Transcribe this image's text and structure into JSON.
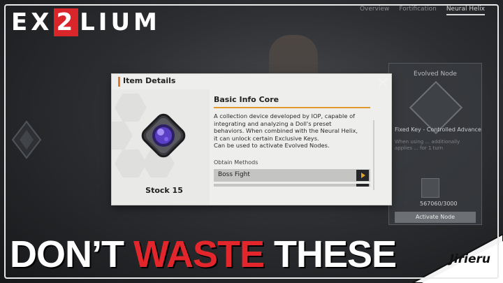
{
  "logo": {
    "prefix": "EX",
    "mark": "2",
    "suffix": "LIUM"
  },
  "game_tabs": [
    "Overview",
    "Fortification",
    "Neural Helix"
  ],
  "side_panel": {
    "title": "Evolved Node",
    "key_label": "Fixed Key - Controlled Advance",
    "description": "When using ... additionally applies ... for 1 turn",
    "count": "567060/3000",
    "activate_label": "Activate Node"
  },
  "modal": {
    "header": "Item Details",
    "item_name": "Basic Info Core",
    "stock": "Stock 15",
    "description": [
      "A collection device developed by IOP, capable of",
      "integrating and analyzing a Doll's preset",
      "behaviors. When combined with the Neural Helix,",
      "it can unlock certain Exclusive Keys.",
      "Can be used to activate Evolved Nodes."
    ],
    "obtain_label": "Obtain Methods",
    "methods": [
      "Boss Fight"
    ]
  },
  "headline": {
    "part1": "DON’T ",
    "highlight": "WASTE",
    "part2": " THESE"
  },
  "badge": "Jirieru",
  "colors": {
    "accent_orange": "#e3772a",
    "headline_red": "#e3262b",
    "logo_red": "#d8262a"
  }
}
